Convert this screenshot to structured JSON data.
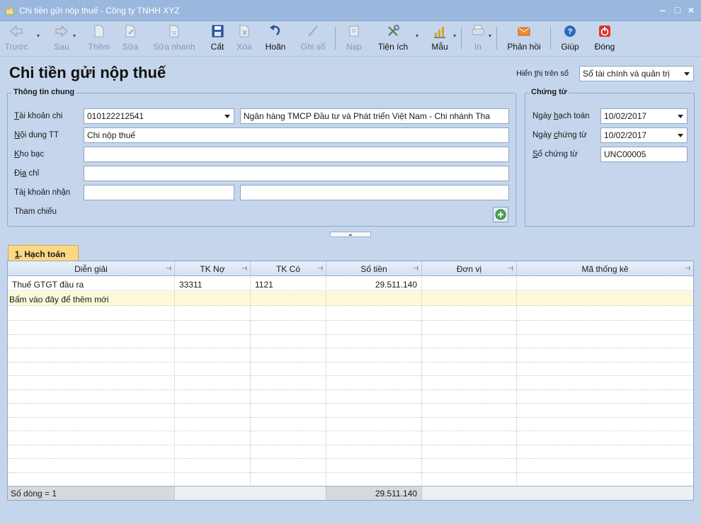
{
  "window": {
    "title": "Chi tiền gửi nộp thuế - Công ty TNHH XYZ",
    "minimize": "–",
    "maximize": "□",
    "close": "×"
  },
  "toolbar": {
    "back": "Trước",
    "forward": "Sau",
    "add": "Thêm",
    "edit": "Sửa",
    "quick_edit": "Sửa nhanh",
    "save": "Cất",
    "delete": "Xóa",
    "undo": "Hoãn",
    "post": "Ghi sổ",
    "load": "Nạp",
    "utilities": "Tiện ích",
    "template": "Mẫu",
    "print": "In",
    "feedback": "Phản hồi",
    "help": "Giúp",
    "close": "Đóng"
  },
  "header": {
    "title": "Chi tiền gửi nộp thuế",
    "book_label_prefix": "Hiển ",
    "book_label_u": "t",
    "book_label_suffix": "hị trên sổ",
    "book_value": "Sổ tài chính và quản trị"
  },
  "general": {
    "title": "Thông tin chung",
    "account_label_u": "T",
    "account_label": "ài khoản chi",
    "account_value": "010122212541",
    "bank_name": "Ngân hàng TMCP Đầu tư và Phát triển Việt Nam - Chi nhánh Tha",
    "content_label_u": "N",
    "content_label": "ội dung TT",
    "content_value": "Chi nộp thuế",
    "treasury_label_u": "K",
    "treasury_label": "ho bạc",
    "treasury_value": "",
    "address_label_pre": "Đị",
    "address_label_u": "a",
    "address_label": " chỉ",
    "address_value": "",
    "recv_label_pre": "Tà",
    "recv_label_u": "i",
    "recv_label": " khoản nhận",
    "recv_value": "",
    "recv_value2": "",
    "ref_label": "Tham chiếu"
  },
  "voucher": {
    "title": "Chứng từ",
    "post_date_label_pre": "Ngày ",
    "post_date_label_u": "h",
    "post_date_label": "ạch toán",
    "post_date": "10/02/2017",
    "doc_date_label_pre": "Ngày ",
    "doc_date_label_u": "c",
    "doc_date_label": "hứng từ",
    "doc_date": "10/02/2017",
    "doc_no_label_u": "S",
    "doc_no_label": "ố chứng từ",
    "doc_no": "UNC00005"
  },
  "tab": {
    "num": "1",
    "label": ". Hạch toán"
  },
  "grid": {
    "columns": [
      "Diễn giải",
      "TK Nợ",
      "TK Có",
      "Số tiền",
      "Đơn vị",
      "Mã thống kê"
    ],
    "rows": [
      {
        "desc": "Thuế GTGT đầu ra",
        "debit": "33311",
        "credit": "1121",
        "amount": "29.511.140",
        "unit": "",
        "stat": ""
      }
    ],
    "new_row_hint": "Bấm vào đây để thêm mới",
    "footer_count": "Số dòng = 1",
    "footer_total": "29.511.140"
  }
}
